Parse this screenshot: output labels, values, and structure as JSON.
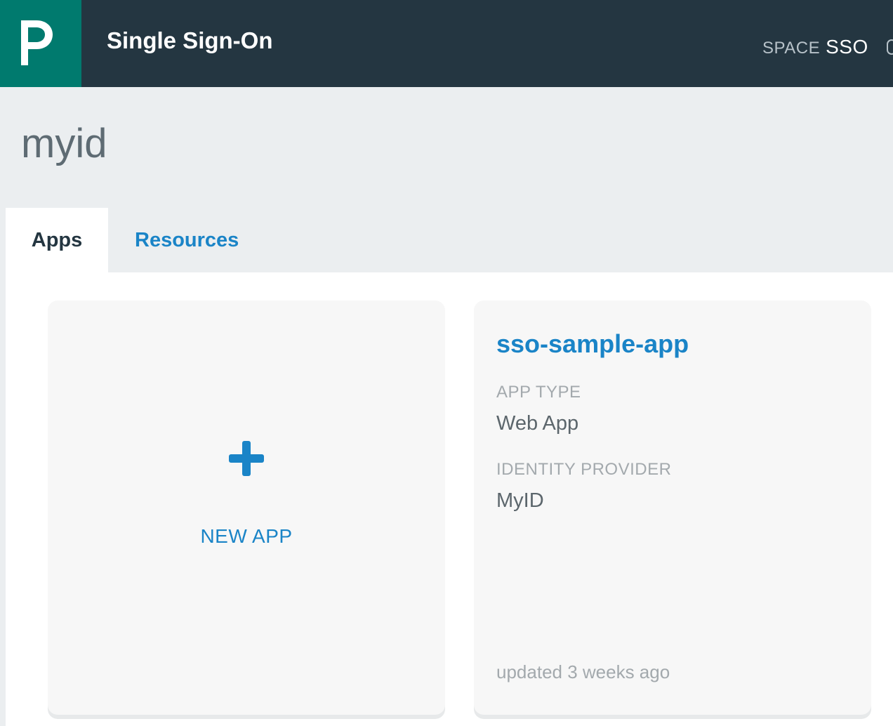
{
  "header": {
    "logo_icon": "pivotal-p-logo-icon",
    "title": "Single Sign-On",
    "space_label": "SPACE",
    "space_name": "SSO"
  },
  "colors": {
    "header_bg": "#243641",
    "logo_bg": "#007a6e",
    "accent": "#1a84c7",
    "band_bg": "#ebeef0",
    "card_bg": "#f7f7f7"
  },
  "page": {
    "title": "myid"
  },
  "tabs": [
    {
      "label": "Apps",
      "active": true
    },
    {
      "label": "Resources",
      "active": false
    }
  ],
  "cards": {
    "new_app": {
      "icon": "plus-icon",
      "label": "NEW APP"
    },
    "apps": [
      {
        "name": "sso-sample-app",
        "app_type_label": "APP TYPE",
        "app_type": "Web App",
        "identity_provider_label": "IDENTITY PROVIDER",
        "identity_provider": "MyID",
        "updated": "updated 3 weeks ago"
      }
    ]
  }
}
